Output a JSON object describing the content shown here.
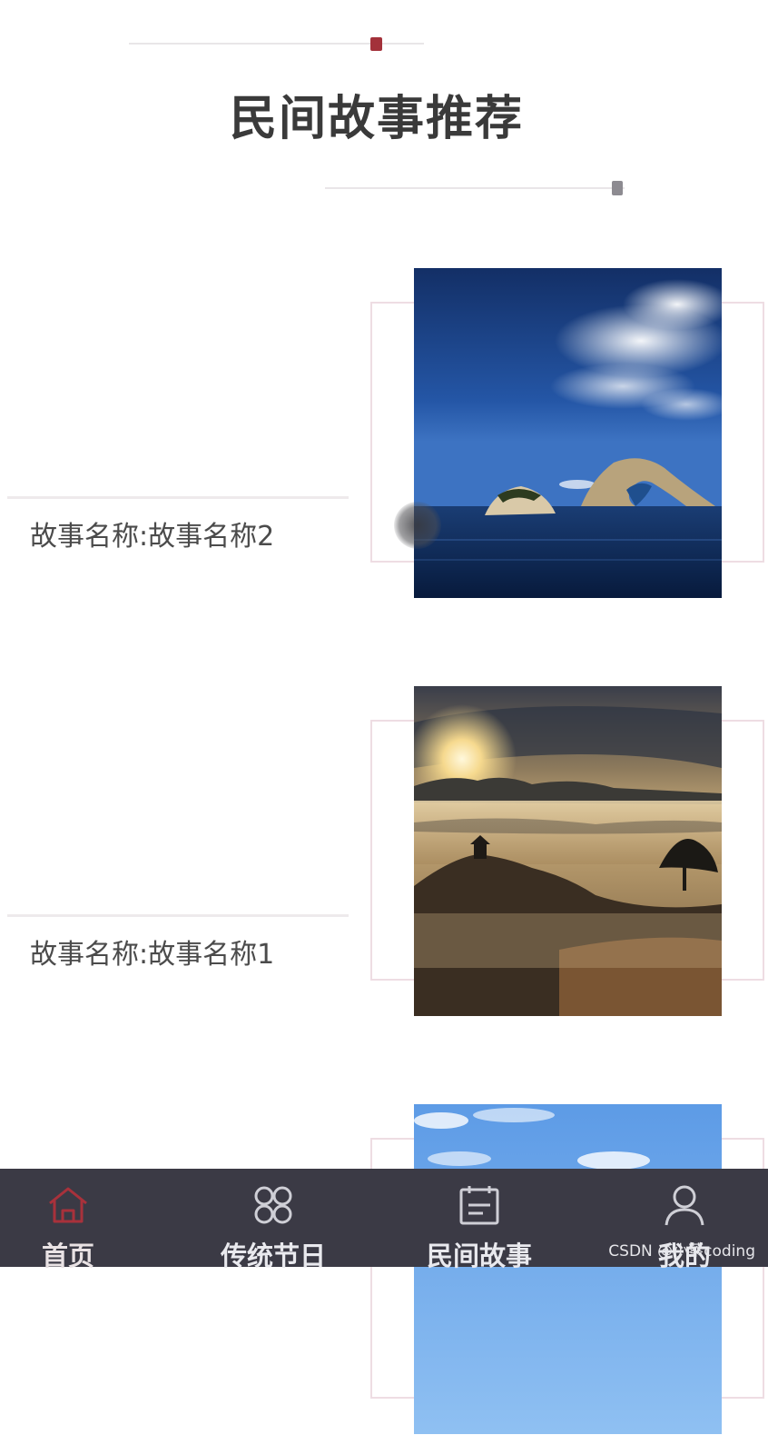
{
  "colors": {
    "accent_red": "#a3313a",
    "deco_gray": "#8d8b91",
    "tabbar_bg": "#3b3a45",
    "tab_active": "#a8313b",
    "tab_inactive": "#cfcfd6"
  },
  "section": {
    "title": "民间故事推荐"
  },
  "stories": [
    {
      "name": "故事名称:故事名称2",
      "image": "sea-arch-rock-photo"
    },
    {
      "name": "故事名称:故事名称1",
      "image": "sunrise-sea-of-clouds-photo"
    },
    {
      "name": "",
      "image": "blue-sky-photo"
    }
  ],
  "tabbar": {
    "tabs": [
      {
        "label": "首页",
        "icon": "home-icon",
        "active": true
      },
      {
        "label": "传统节日",
        "icon": "clover-grid-icon",
        "active": false
      },
      {
        "label": "民间故事",
        "icon": "calendar-icon",
        "active": false
      },
      {
        "label": "我的",
        "icon": "user-icon",
        "active": false
      }
    ]
  },
  "watermark": "CSDN @小蔡coding"
}
